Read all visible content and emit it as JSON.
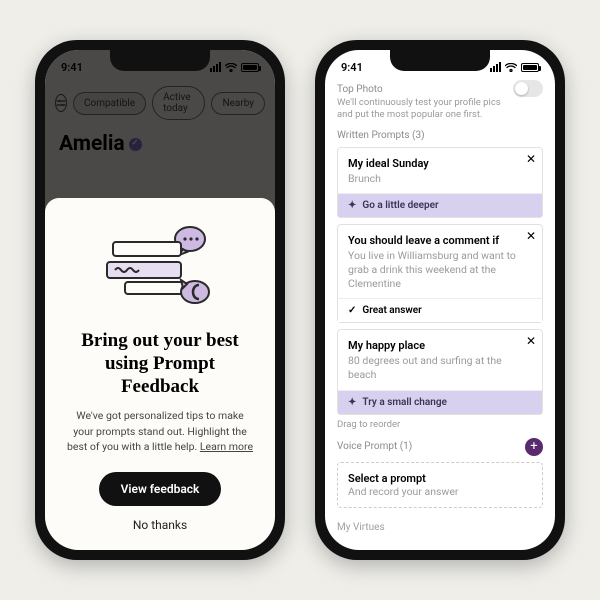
{
  "statusbar": {
    "time": "9:41"
  },
  "left": {
    "chips": {
      "compatible": "Compatible",
      "active": "Active today",
      "nearby": "Nearby"
    },
    "profile_name": "Amelia",
    "modal": {
      "title_line1": "Bring out your best",
      "title_line2": "using Prompt Feedback",
      "body": "We've got personalized tips to make your prompts stand out. Highlight the best of you with a little help. ",
      "learn_more": "Learn more",
      "primary": "View feedback",
      "secondary": "No thanks"
    }
  },
  "right": {
    "top_photo": {
      "label": "Top Photo",
      "hint": "We'll continuously test your profile pics and put the most popular one first."
    },
    "written": {
      "label": "Written Prompts (3)",
      "drag": "Drag to reorder"
    },
    "prompts": [
      {
        "title": "My ideal Sunday",
        "answer": "Brunch",
        "feedback": "Go a little deeper",
        "feedback_kind": "lav"
      },
      {
        "title": "You should leave a comment if",
        "answer": "You live in Williamsburg and want to grab a drink this weekend at the Clementine",
        "feedback": "Great answer",
        "feedback_kind": "plain"
      },
      {
        "title": "My happy place",
        "answer": "80 degrees out and surfing at the beach",
        "feedback": "Try a small change",
        "feedback_kind": "lav"
      }
    ],
    "voice": {
      "label": "Voice Prompt (1)",
      "select": "Select a prompt",
      "sub": "And record your answer"
    },
    "virtues": "My Virtues"
  }
}
